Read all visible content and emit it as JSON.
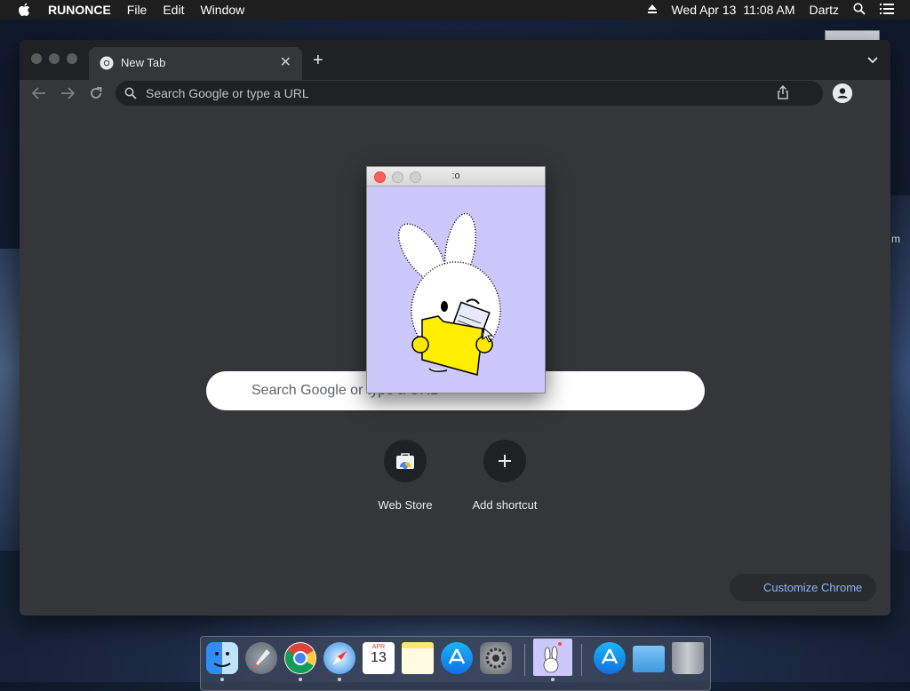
{
  "menubar": {
    "app_name": "RUNONCE",
    "menus": [
      "File",
      "Edit",
      "Window"
    ],
    "date": "Wed Apr 13",
    "time": "11:08 AM",
    "user": "Dartz"
  },
  "desktop": {
    "edge_text": "m"
  },
  "browser": {
    "tab_title": "New Tab",
    "omnibox_placeholder": "Search Google or type a URL",
    "ntp_search_placeholder": "Search Google or type a URL",
    "shortcuts": [
      "Web Store",
      "Add shortcut"
    ],
    "customize_label": "Customize Chrome"
  },
  "popup": {
    "title": ":o"
  },
  "dock": {
    "calendar_month": "APR",
    "calendar_day": "13",
    "items": [
      "finder-icon",
      "launchpad-icon",
      "chrome-icon",
      "safari-icon",
      "calendar-icon",
      "notes-icon",
      "app-store-icon",
      "system-preferences-icon",
      "bunny-app-icon",
      "app-store-folder-icon",
      "folder-icon",
      "trash-icon"
    ]
  },
  "colors": {
    "ntp_bg": "#35363a",
    "customize_text": "#8ab4f8",
    "popup_bg": "#cdc8fb"
  }
}
